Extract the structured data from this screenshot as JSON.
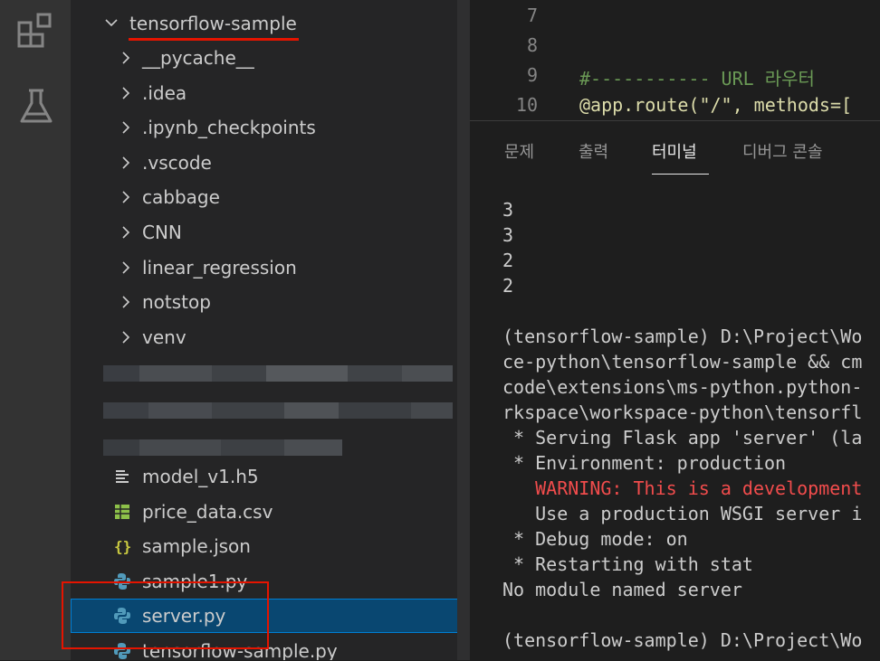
{
  "explorer": {
    "root": {
      "label": "tensorflow-sample",
      "expanded": true
    },
    "folders": [
      {
        "label": "__pycache__"
      },
      {
        "label": ".idea"
      },
      {
        "label": ".ipynb_checkpoints"
      },
      {
        "label": ".vscode"
      },
      {
        "label": "cabbage"
      },
      {
        "label": "CNN"
      },
      {
        "label": "linear_regression"
      },
      {
        "label": "notstop"
      },
      {
        "label": "venv"
      }
    ],
    "files": [
      {
        "label": "model_v1.h5",
        "icon": "lines-icon"
      },
      {
        "label": "price_data.csv",
        "icon": "table-icon"
      },
      {
        "label": "sample.json",
        "icon": "braces-icon"
      },
      {
        "label": "sample1.py",
        "icon": "python-icon"
      },
      {
        "label": "server.py",
        "icon": "python-icon",
        "selected": true
      },
      {
        "label": "tensorflow-sample.py",
        "icon": "python-icon"
      }
    ]
  },
  "editor": {
    "lines": [
      {
        "num": "7",
        "text": ""
      },
      {
        "num": "8",
        "text": ""
      },
      {
        "num": "9",
        "text": "#----------- URL 라우터"
      },
      {
        "num": "10",
        "text": "@app.route(\"/\", methods=["
      }
    ]
  },
  "panel": {
    "tabs": [
      {
        "label": "문제",
        "active": false
      },
      {
        "label": "출력",
        "active": false
      },
      {
        "label": "터미널",
        "active": true
      },
      {
        "label": "디버그 콘솔",
        "active": false
      }
    ],
    "terminal_lines": [
      {
        "text": "3"
      },
      {
        "text": "3"
      },
      {
        "text": "2"
      },
      {
        "text": "2"
      },
      {
        "text": ""
      },
      {
        "text": "(tensorflow-sample) D:\\Project\\Wo"
      },
      {
        "text": "ce-python\\tensorflow-sample && cm"
      },
      {
        "text": "code\\extensions\\ms-python.python-"
      },
      {
        "text": "rkspace\\workspace-python\\tensorfl"
      },
      {
        "text": " * Serving Flask app 'server' (la"
      },
      {
        "text": " * Environment: production"
      },
      {
        "text": "   WARNING: This is a development",
        "warn": true
      },
      {
        "text": "   Use a production WSGI server i"
      },
      {
        "text": " * Debug mode: on"
      },
      {
        "text": " * Restarting with stat"
      },
      {
        "text": "No module named server"
      },
      {
        "text": ""
      },
      {
        "text": "(tensorflow-sample) D:\\Project\\Wo"
      }
    ]
  },
  "colors": {
    "annotation_red": "#e51400",
    "selection_bg": "#094771",
    "warning_text": "#f14c4c",
    "python_blue": "#519aba",
    "json_yellow": "#cbcb41",
    "csv_green": "#8dc149"
  }
}
